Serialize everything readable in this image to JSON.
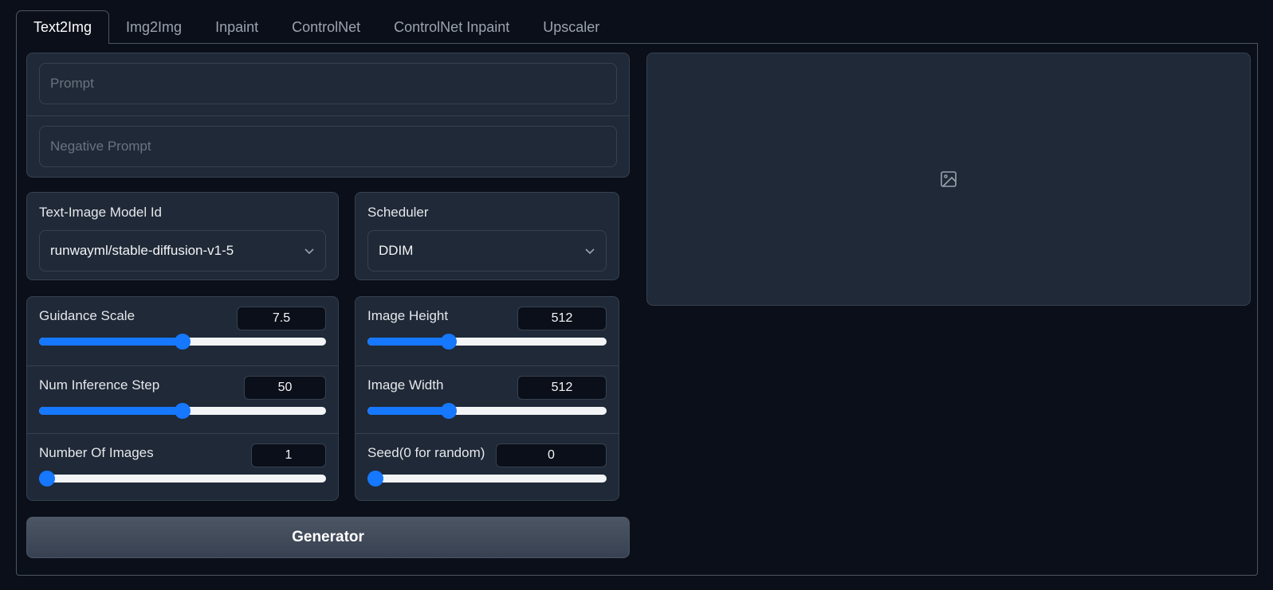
{
  "tabs": [
    "Text2Img",
    "Img2Img",
    "Inpaint",
    "ControlNet",
    "ControlNet Inpaint",
    "Upscaler"
  ],
  "active_tab": "Text2Img",
  "prompts": {
    "prompt_placeholder": "Prompt",
    "negative_placeholder": "Negative Prompt"
  },
  "model": {
    "label": "Text-Image Model Id",
    "value": "runwayml/stable-diffusion-v1-5"
  },
  "scheduler": {
    "label": "Scheduler",
    "value": "DDIM"
  },
  "sliders": {
    "guidance_scale": {
      "label": "Guidance Scale",
      "value": "7.5",
      "fraction": 0.5
    },
    "num_inference_step": {
      "label": "Num Inference Step",
      "value": "50",
      "fraction": 0.5
    },
    "number_of_images": {
      "label": "Number Of Images",
      "value": "1",
      "fraction": 0.0
    },
    "image_height": {
      "label": "Image Height",
      "value": "512",
      "fraction": 0.34
    },
    "image_width": {
      "label": "Image Width",
      "value": "512",
      "fraction": 0.34
    },
    "seed": {
      "label": "Seed(0 for random)",
      "value": "0",
      "fraction": 0.0
    }
  },
  "generate_button": "Generator",
  "output": {
    "icon": "image-icon"
  },
  "colors": {
    "accent": "#1677ff",
    "background": "#0b0f19",
    "panel": "#1f2937"
  }
}
